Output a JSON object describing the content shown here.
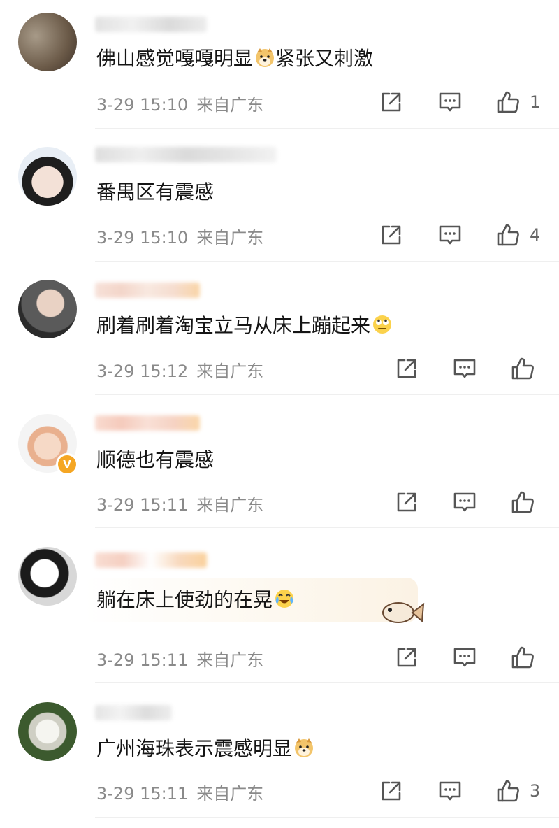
{
  "comments": [
    {
      "text": "佛山感觉嘎嘎明显",
      "text2": "紧张又刺激",
      "emoji": "doge-emoji",
      "time": "3-29 15:10",
      "location": "来自广东",
      "likes": "1"
    },
    {
      "text": "番禺区有震感",
      "text2": "",
      "emoji": "",
      "time": "3-29 15:10",
      "location": "来自广东",
      "likes": "4"
    },
    {
      "text": "刷着刷着淘宝立马从床上蹦起来",
      "text2": "",
      "emoji": "eye-roll-emoji",
      "time": "3-29 15:12",
      "location": "来自广东",
      "likes": ""
    },
    {
      "text": "顺德也有震感",
      "text2": "",
      "emoji": "",
      "time": "3-29 15:11",
      "location": "来自广东",
      "likes": "",
      "verified_mark": "V"
    },
    {
      "text": "躺在床上使劲的在晃",
      "text2": "",
      "emoji": "laugh-cry-emoji",
      "time": "3-29 15:11",
      "location": "来自广东",
      "likes": ""
    },
    {
      "text": "广州海珠表示震感明显",
      "text2": "",
      "emoji": "doge-emoji",
      "time": "3-29 15:11",
      "location": "来自广东",
      "likes": "3"
    }
  ],
  "icons": {
    "repost": "repost-icon",
    "comment": "comment-icon",
    "like": "thumbs-up-icon"
  },
  "colors": {
    "meta_text": "#8a8a8a",
    "divider": "#efefef",
    "verified": "#f5a623"
  }
}
